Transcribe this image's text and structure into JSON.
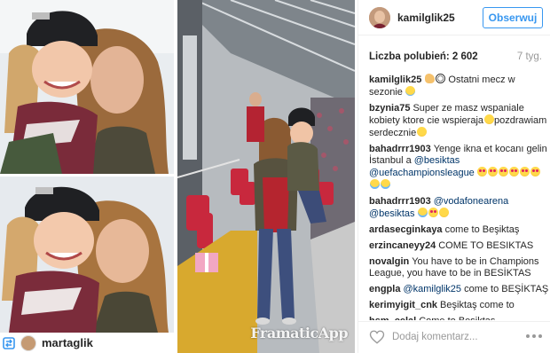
{
  "post": {
    "username": "kamilglik25",
    "follow_label": "Obserwuj",
    "likes_label": "Liczba polubień: 2 602",
    "age": "7 tyg.",
    "comment_placeholder": "Dodaj komentarz...",
    "watermark": "FramaticApp",
    "credit_name": "martaglik"
  },
  "comments": [
    {
      "author": "kamilglik25",
      "parts": [
        {
          "t": "text",
          "v": ""
        },
        {
          "t": "emoji",
          "k": "muscle"
        },
        {
          "t": "emoji",
          "k": "ball"
        },
        {
          "t": "text",
          "v": " Ostatni mecz w sezonie "
        },
        {
          "t": "emoji",
          "k": "sad"
        }
      ]
    },
    {
      "author": "bzynia75",
      "parts": [
        {
          "t": "text",
          "v": "Super ze masz wspaniale kobiety ktore cie wspieraja"
        },
        {
          "t": "emoji",
          "k": "smile"
        },
        {
          "t": "text",
          "v": "pozdrawiam serdecznie"
        },
        {
          "t": "emoji",
          "k": "smile"
        }
      ]
    },
    {
      "author": "bahadrrr1903",
      "parts": [
        {
          "t": "text",
          "v": "Yenge ikna et kocanı gelin İstanbul a "
        },
        {
          "t": "mention",
          "v": "@besiktas"
        },
        {
          "t": "text",
          "v": " "
        },
        {
          "t": "mention",
          "v": "@uefachampionsleague"
        },
        {
          "t": "text",
          "v": " "
        },
        {
          "t": "emoji",
          "k": "heart-eyes"
        },
        {
          "t": "emoji",
          "k": "heart-eyes"
        },
        {
          "t": "emoji",
          "k": "heart-eyes"
        },
        {
          "t": "emoji",
          "k": "heart-eyes"
        },
        {
          "t": "emoji",
          "k": "heart-eyes"
        },
        {
          "t": "emoji",
          "k": "heart-eyes"
        },
        {
          "t": "emoji",
          "k": "tears"
        },
        {
          "t": "emoji",
          "k": "tears"
        }
      ]
    },
    {
      "author": "bahadrrr1903",
      "parts": [
        {
          "t": "mention",
          "v": "@vodafonearena"
        },
        {
          "t": "text",
          "v": " "
        },
        {
          "t": "mention",
          "v": "@besiktas"
        },
        {
          "t": "text",
          "v": " "
        },
        {
          "t": "emoji",
          "k": "tears"
        },
        {
          "t": "emoji",
          "k": "heart-eyes"
        },
        {
          "t": "emoji",
          "k": "smile"
        }
      ]
    },
    {
      "author": "ardasecginkaya",
      "parts": [
        {
          "t": "text",
          "v": "come to Beşiktaş"
        }
      ]
    },
    {
      "author": "erzincaneyy24",
      "parts": [
        {
          "t": "text",
          "v": "COME TO BESIKTAS"
        }
      ]
    },
    {
      "author": "novalgin",
      "parts": [
        {
          "t": "text",
          "v": "You have to be in Champions League, you have to be in BESİKTAS"
        }
      ]
    },
    {
      "author": "engpla",
      "parts": [
        {
          "t": "mention",
          "v": "@kamilglik25"
        },
        {
          "t": "text",
          "v": " come to BEŞİKTAŞ"
        }
      ]
    },
    {
      "author": "kerimyigit_cnk",
      "parts": [
        {
          "t": "text",
          "v": "Beşiktaş come to"
        }
      ]
    },
    {
      "author": "hsm_celal",
      "parts": [
        {
          "t": "text",
          "v": "Come to Beşiktaş"
        }
      ]
    }
  ],
  "colors": {
    "accent": "#3897f0",
    "mention": "#003569",
    "muted": "#999999",
    "text": "#262626"
  },
  "icons": {
    "like": "heart-icon",
    "more": "more-icon",
    "repost": "repost-icon"
  }
}
